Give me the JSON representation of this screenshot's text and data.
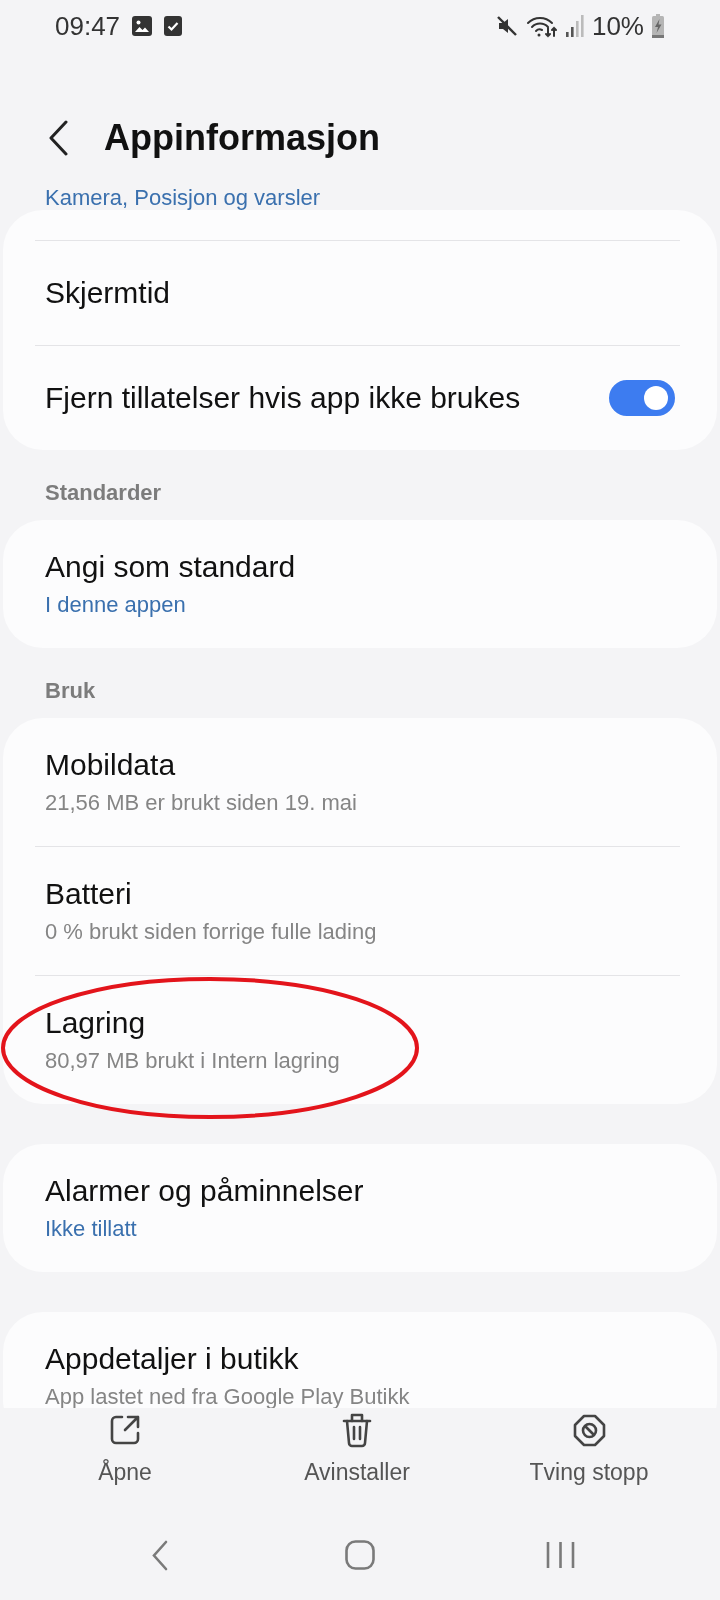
{
  "status_bar": {
    "time": "09:47",
    "battery": "10%"
  },
  "header": {
    "title": "Appinformasjon"
  },
  "list": {
    "peek_subtitle": {
      "text": "Kamera, Posisjon og varsler",
      "accent": true
    },
    "sections": [
      {
        "items": [
          {
            "title": "Skjermtid",
            "kind": "link",
            "circled": false
          },
          {
            "title": "Fjern tillatelser hvis app ikke brukes",
            "kind": "toggle",
            "on": true,
            "circled": false
          }
        ]
      },
      {
        "heading": "Standarder",
        "items": [
          {
            "title": "Angi som standard",
            "subtitle": "I denne appen",
            "accent": true,
            "kind": "link",
            "circled": false
          }
        ]
      },
      {
        "heading": "Bruk",
        "items": [
          {
            "title": "Mobildata",
            "subtitle": "21,56 MB er brukt siden 19. mai",
            "accent": false,
            "kind": "link",
            "circled": false
          },
          {
            "title": "Batteri",
            "subtitle": "0 % brukt siden forrige fulle lading",
            "accent": false,
            "kind": "link",
            "circled": false
          },
          {
            "title": "Lagring",
            "subtitle": "80,97 MB brukt i Intern lagring",
            "accent": false,
            "kind": "link",
            "circled": true
          }
        ]
      },
      {
        "items": [
          {
            "title": "Alarmer og påminnelser",
            "subtitle": "Ikke tillatt",
            "accent": true,
            "kind": "link",
            "circled": false
          }
        ]
      },
      {
        "items": [
          {
            "title": "Appdetaljer i butikk",
            "subtitle": "App lastet ned fra Google Play Butikk",
            "accent": false,
            "kind": "link",
            "circled": false
          }
        ]
      }
    ]
  },
  "actions": [
    {
      "kind": "open",
      "label": "Åpne"
    },
    {
      "kind": "uninstall",
      "label": "Avinstaller"
    },
    {
      "kind": "force_stop",
      "label": "Tving stopp"
    }
  ]
}
